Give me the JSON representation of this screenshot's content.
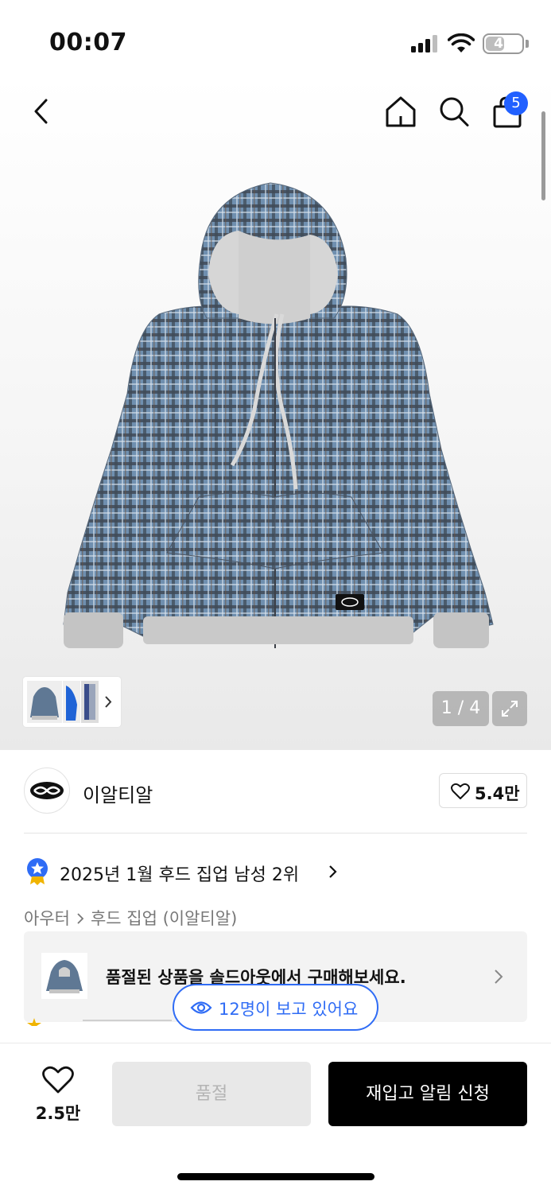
{
  "status_bar": {
    "time": "00:07",
    "battery": "47"
  },
  "nav": {
    "cart_count": "5"
  },
  "gallery": {
    "page_indicator": "1 / 4"
  },
  "brand": {
    "name": "이알티알",
    "like_count": "5.4만"
  },
  "ranking": {
    "text": "2025년 1월 후드 집업 남성 2위"
  },
  "breadcrumb": {
    "category": "아우터",
    "subcategory": "후드 집업 (이알티알)"
  },
  "soldout_banner": {
    "text": "품절된 상품을 솔드아웃에서 구매해보세요."
  },
  "viewers": {
    "text": "12명이 보고 있어요"
  },
  "bottom_bar": {
    "wish_count": "2.5만",
    "soldout_label": "품절",
    "restock_label": "재입고 알림 신청"
  },
  "colors": {
    "accent_blue": "#2f6cf5",
    "badge_blue": "#2160ff",
    "primary_black": "#000000"
  }
}
